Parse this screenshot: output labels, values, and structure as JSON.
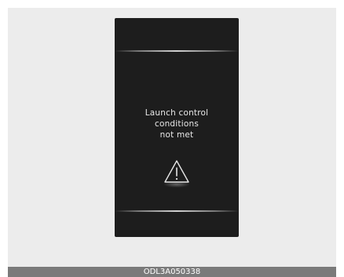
{
  "display": {
    "message_lines": [
      "Launch control",
      "conditions",
      "not met"
    ],
    "icon": "warning-triangle-icon"
  },
  "footer": {
    "code": "ODL3A050338"
  }
}
